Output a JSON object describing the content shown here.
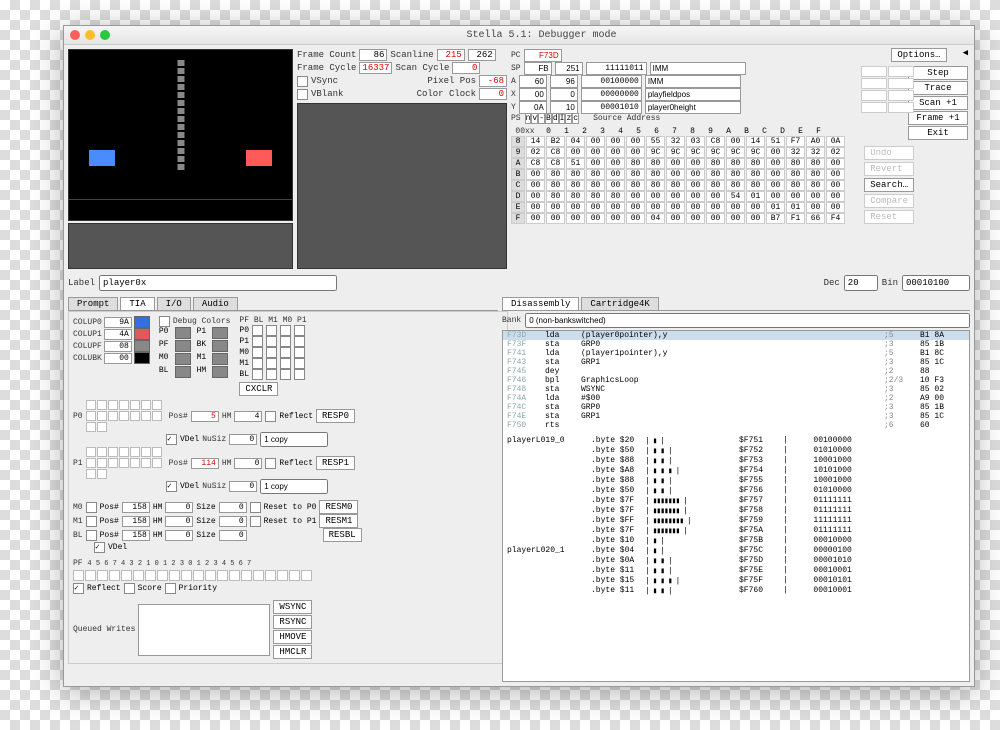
{
  "title": "Stella 5.1: Debugger mode",
  "frame": {
    "frameCountLbl": "Frame Count",
    "frameCount": "86",
    "frameCycleLbl": "Frame Cycle",
    "frameCycle": "16337",
    "scanlineLbl": "Scanline",
    "scanline1": "215",
    "scanline2": "262",
    "scanCycleLbl": "Scan Cycle",
    "scanCycle": "0",
    "vsyncLbl": "VSync",
    "vblankLbl": "VBlank",
    "pixelPosLbl": "Pixel Pos",
    "pixelPos": "-68",
    "colorClockLbl": "Color Clock",
    "colorClock": "0"
  },
  "regs": {
    "pcLbl": "PC",
    "pc": "F73D",
    "spLbl": "SP",
    "sp": "FB",
    "spDec": "251",
    "spBin": "11111011",
    "spTxt": "IMM",
    "aLbl": "A",
    "a": "60",
    "aDec": "96",
    "aBin": "00100000",
    "aTxt": "IMM",
    "xLbl": "X",
    "x": "00",
    "xDec": "0",
    "xBin": "00000000",
    "xTxt": "playfieldpos",
    "yLbl": "Y",
    "y": "0A",
    "yDec": "10",
    "yBin": "00001010",
    "yTxt": "player0height",
    "psLbl": "PS",
    "psFlags": [
      "n",
      "v",
      "-",
      "B",
      "d",
      "I",
      "z",
      "c"
    ],
    "srcAddrLbl": "Source Address"
  },
  "topbtns": {
    "options": "Options…",
    "step": "Step",
    "trace": "Trace",
    "scan": "Scan +1",
    "frame": "Frame +1",
    "exit": "Exit"
  },
  "mem": {
    "header": [
      "0",
      "1",
      "2",
      "3",
      "4",
      "5",
      "6",
      "7",
      "8",
      "9",
      "A",
      "B",
      "C",
      "D",
      "E",
      "F"
    ],
    "rowLabel": "00xx",
    "rows": [
      {
        "l": "8",
        "c": [
          "14",
          "B2",
          "04",
          "00",
          "00",
          "00",
          "55",
          "32",
          "03",
          "C8",
          "00",
          "14",
          "51",
          "F7",
          "A0",
          "0A"
        ]
      },
      {
        "l": "9",
        "c": [
          "02",
          "C8",
          "00",
          "00",
          "00",
          "00",
          "9C",
          "9C",
          "9C",
          "9C",
          "9C",
          "9C",
          "00",
          "32",
          "32",
          "02"
        ]
      },
      {
        "l": "A",
        "c": [
          "C8",
          "C8",
          "51",
          "00",
          "00",
          "80",
          "80",
          "00",
          "00",
          "80",
          "80",
          "80",
          "00",
          "80",
          "80",
          "00"
        ]
      },
      {
        "l": "B",
        "c": [
          "00",
          "80",
          "80",
          "80",
          "00",
          "80",
          "80",
          "00",
          "00",
          "80",
          "80",
          "80",
          "00",
          "80",
          "80",
          "00"
        ]
      },
      {
        "l": "C",
        "c": [
          "00",
          "80",
          "80",
          "80",
          "00",
          "80",
          "80",
          "80",
          "00",
          "80",
          "80",
          "80",
          "00",
          "80",
          "80",
          "00"
        ]
      },
      {
        "l": "D",
        "c": [
          "00",
          "80",
          "80",
          "80",
          "80",
          "00",
          "00",
          "00",
          "00",
          "00",
          "54",
          "01",
          "00",
          "00",
          "00",
          "00"
        ]
      },
      {
        "l": "E",
        "c": [
          "00",
          "00",
          "00",
          "00",
          "00",
          "00",
          "00",
          "00",
          "00",
          "00",
          "00",
          "00",
          "01",
          "01",
          "00",
          "00"
        ]
      },
      {
        "l": "F",
        "c": [
          "00",
          "00",
          "00",
          "00",
          "00",
          "00",
          "04",
          "00",
          "00",
          "00",
          "00",
          "00",
          "B7",
          "F1",
          "66",
          "F4"
        ]
      }
    ]
  },
  "membtns": {
    "undo": "Undo",
    "revert": "Revert",
    "search": "Search…",
    "compare": "Compare",
    "reset": "Reset"
  },
  "tabsLeft": [
    "Prompt",
    "TIA",
    "I/O",
    "Audio"
  ],
  "color": {
    "debugColorsLbl": "Debug Colors",
    "items": [
      {
        "n": "COLUP0",
        "v": "9A",
        "c": "#3070e0"
      },
      {
        "n": "COLUP1",
        "v": "4A",
        "c": "#e05a5a"
      },
      {
        "n": "COLUPF",
        "v": "08",
        "c": "#888"
      },
      {
        "n": "COLUBK",
        "v": "00",
        "c": "#000"
      }
    ],
    "legend": [
      "P0",
      "P1",
      "PF",
      "BK",
      "M0",
      "M1",
      "BL",
      "HM"
    ],
    "pfHeader": "PF BL M1 M0 P1",
    "pfCols": [
      "P0",
      "P1",
      "M0",
      "M1",
      "BL"
    ]
  },
  "players": {
    "p0": {
      "lbl": "P0",
      "pos": "5",
      "hm": "4",
      "nusiz": "0",
      "copy": "1 copy",
      "resp": "RESP0"
    },
    "p1": {
      "lbl": "P1",
      "pos": "114",
      "hm": "0",
      "nusiz": "0",
      "copy": "1 copy",
      "resp": "RESP1"
    },
    "posLbl": "Pos#",
    "hmLbl": "HM",
    "reflectLbl": "Reflect",
    "vdelLbl": "VDel",
    "nusizLbl": "NuSiz",
    "cxclr": "CXCLR"
  },
  "missiles": {
    "items": [
      {
        "n": "M0",
        "pos": "158",
        "hm": "0",
        "size": "0",
        "reset": "Reset to P0",
        "btn": "RESM0"
      },
      {
        "n": "M1",
        "pos": "158",
        "hm": "0",
        "size": "0",
        "reset": "Reset to P1",
        "btn": "RESM1"
      },
      {
        "n": "BL",
        "pos": "158",
        "hm": "0",
        "size": "0",
        "reset": "",
        "btn": "RESBL"
      }
    ],
    "sizeLbl": "Size",
    "vdelLbl": "VDel"
  },
  "pf": {
    "lbl": "PF",
    "scale": "4 5 6 7 4 3 2 1 0 1 2 3 0 1 2 3 4 5 6 7",
    "reflectLbl": "Reflect",
    "scoreLbl": "Score",
    "priorityLbl": "Priority"
  },
  "queued": {
    "lbl": "Queued Writes",
    "btns": [
      "WSYNC",
      "RSYNC",
      "HMOVE",
      "HMCLR"
    ]
  },
  "labelRow": {
    "labelLbl": "Label",
    "label": "player0x",
    "decLbl": "Dec",
    "dec": "20",
    "binLbl": "Bin",
    "bin": "00010100"
  },
  "tabsRight": [
    "Disassembly",
    "Cartridge4K"
  ],
  "bank": {
    "lbl": "Bank",
    "val": "0 (non-bankswitched)"
  },
  "disasm": [
    {
      "a": "F73D",
      "op": "lda",
      "arg": "(player0pointer),y",
      "cmt": ";5",
      "b": "B1 8A",
      "hl": true
    },
    {
      "a": "F73F",
      "op": "sta",
      "arg": "GRP0",
      "cmt": ";3",
      "b": "85 1B"
    },
    {
      "a": "F741",
      "op": "lda",
      "arg": "(player1pointer),y",
      "cmt": ";5",
      "b": "B1 8C"
    },
    {
      "a": "F743",
      "op": "sta",
      "arg": "GRP1",
      "cmt": ";3",
      "b": "85 1C"
    },
    {
      "a": "F745",
      "op": "dey",
      "arg": "",
      "cmt": ";2",
      "b": "88"
    },
    {
      "a": "F746",
      "op": "bpl",
      "arg": "GraphicsLoop",
      "cmt": ";2/3",
      "b": "10 F3"
    },
    {
      "a": "F748",
      "op": "sta",
      "arg": "WSYNC",
      "cmt": ";3",
      "b": "85 02"
    },
    {
      "a": "F74A",
      "op": "lda",
      "arg": "#$00",
      "cmt": ";2",
      "b": "A9 00"
    },
    {
      "a": "F74C",
      "op": "sta",
      "arg": "GRP0",
      "cmt": ";3",
      "b": "85 1B"
    },
    {
      "a": "F74E",
      "op": "sta",
      "arg": "GRP1",
      "cmt": ";3",
      "b": "85 1C"
    },
    {
      "a": "F750",
      "op": "rts",
      "arg": "",
      "cmt": ";6",
      "b": "60"
    }
  ],
  "bytes": [
    {
      "lbl": "playerL019_0",
      "v": "$20",
      "g": "   ▮     ",
      "ad": "$F751",
      "bin": "00100000"
    },
    {
      "v": "$50",
      "g": "  ▮ ▮    ",
      "ad": "$F752",
      "bin": "01010000"
    },
    {
      "v": "$88",
      "g": " ▮   ▮   ",
      "ad": "$F753",
      "bin": "10001000"
    },
    {
      "v": "$A8",
      "g": " ▮ ▮ ▮   ",
      "ad": "$F754",
      "bin": "10101000"
    },
    {
      "v": "$88",
      "g": " ▮   ▮   ",
      "ad": "$F755",
      "bin": "10001000"
    },
    {
      "v": "$50",
      "g": "  ▮ ▮    ",
      "ad": "$F756",
      "bin": "01010000"
    },
    {
      "v": "$7F",
      "g": " ▮▮▮▮▮▮▮ ",
      "ad": "$F757",
      "bin": "01111111"
    },
    {
      "v": "$7F",
      "g": " ▮▮▮▮▮▮▮ ",
      "ad": "$F758",
      "bin": "01111111"
    },
    {
      "v": "$FF",
      "g": "▮▮▮▮▮▮▮▮",
      "ad": "$F759",
      "bin": "11111111"
    },
    {
      "v": "$7F",
      "g": " ▮▮▮▮▮▮▮ ",
      "ad": "$F75A",
      "bin": "01111111"
    },
    {
      "v": "$10",
      "g": "    ▮    ",
      "ad": "$F75B",
      "bin": "00010000"
    },
    {
      "lbl": "playerL020_1",
      "v": "$04",
      "g": "      ▮  ",
      "ad": "$F75C",
      "bin": "00000100"
    },
    {
      "v": "$0A",
      "g": "     ▮ ▮ ",
      "ad": "$F75D",
      "bin": "00001010"
    },
    {
      "v": "$11",
      "g": "    ▮   ▮",
      "ad": "$F75E",
      "bin": "00010001"
    },
    {
      "v": "$15",
      "g": "    ▮ ▮ ▮",
      "ad": "$F75F",
      "bin": "00010101"
    },
    {
      "v": "$11",
      "g": "    ▮   ▮",
      "ad": "$F760",
      "bin": "00010001"
    }
  ]
}
